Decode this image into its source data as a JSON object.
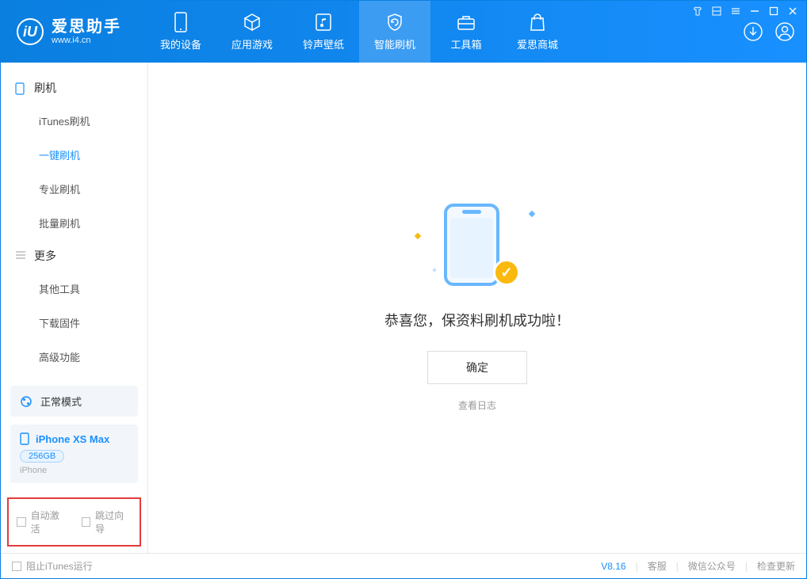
{
  "app": {
    "title": "爱思助手",
    "subtitle": "www.i4.cn"
  },
  "nav": {
    "items": [
      {
        "label": "我的设备"
      },
      {
        "label": "应用游戏"
      },
      {
        "label": "铃声壁纸"
      },
      {
        "label": "智能刷机"
      },
      {
        "label": "工具箱"
      },
      {
        "label": "爱思商城"
      }
    ],
    "active_index": 3
  },
  "sidebar": {
    "group1": {
      "title": "刷机",
      "items": [
        "iTunes刷机",
        "一键刷机",
        "专业刷机",
        "批量刷机"
      ],
      "active_index": 1
    },
    "group2": {
      "title": "更多",
      "items": [
        "其他工具",
        "下载固件",
        "高级功能"
      ]
    }
  },
  "device": {
    "mode": "正常模式",
    "name": "iPhone XS Max",
    "capacity": "256GB",
    "type": "iPhone"
  },
  "options": {
    "auto_activate": "自动激活",
    "skip_guide": "跳过向导"
  },
  "main": {
    "success_text": "恭喜您，保资料刷机成功啦！",
    "ok_button": "确定",
    "log_link": "查看日志"
  },
  "footer": {
    "block_itunes": "阻止iTunes运行",
    "version": "V8.16",
    "links": [
      "客服",
      "微信公众号",
      "检查更新"
    ]
  },
  "colors": {
    "accent": "#1890ff",
    "highlight_border": "#e23b3b",
    "badge": "#f9b90f"
  }
}
